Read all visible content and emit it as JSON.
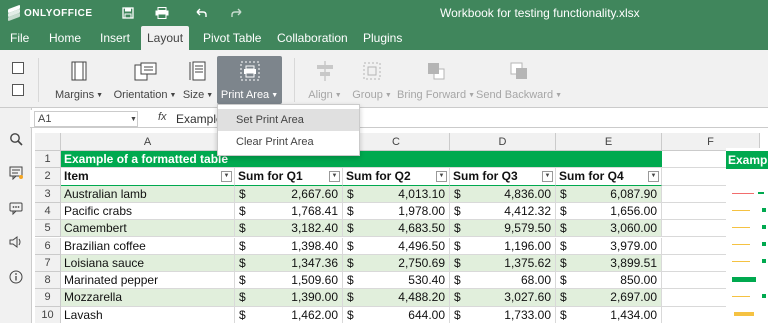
{
  "app": {
    "logo": "ONLYOFFICE",
    "title": "Workbook for testing functionality.xlsx"
  },
  "menu": {
    "tabs": [
      "File",
      "Home",
      "Insert",
      "Layout",
      "Pivot Table",
      "Collaboration",
      "Plugins"
    ],
    "active": "Layout"
  },
  "toolbar": {
    "margins": "Margins",
    "orientation": "Orientation",
    "size": "Size",
    "print_area": "Print Area",
    "align": "Align",
    "group": "Group",
    "bring_forward": "Bring Forward",
    "send_backward": "Send Backward"
  },
  "dropdown": {
    "items": [
      "Set Print Area",
      "Clear Print Area"
    ]
  },
  "formula": {
    "cell_ref": "A1",
    "fx": "fx",
    "content": "Example of a f"
  },
  "grid": {
    "columns": [
      "A",
      "B",
      "C",
      "D",
      "E",
      "F"
    ],
    "rows": [
      "1",
      "2",
      "3",
      "4",
      "5",
      "6",
      "7",
      "8",
      "9",
      "10"
    ],
    "title": "Example of a formatted table",
    "headers": [
      "Item",
      "Sum for Q1",
      "Sum for Q2",
      "Sum for Q3",
      "Sum for Q4"
    ],
    "currency": "$",
    "data": [
      [
        "Australian lamb",
        "2,667.60",
        "4,013.10",
        "4,836.00",
        "6,087.90"
      ],
      [
        "Pacific crabs",
        "1,768.41",
        "1,978.00",
        "4,412.32",
        "1,656.00"
      ],
      [
        "Camembert",
        "3,182.40",
        "4,683.50",
        "9,579.50",
        "3,060.00"
      ],
      [
        "Brazilian coffee",
        "1,398.40",
        "4,496.50",
        "1,196.00",
        "3,979.00"
      ],
      [
        "Loisiana sauce",
        "1,347.36",
        "2,750.69",
        "1,375.62",
        "3,899.51"
      ],
      [
        "Marinated pepper",
        "1,509.60",
        "530.40",
        "68.00",
        "850.00"
      ],
      [
        "Mozzarella",
        "1,390.00",
        "4,488.20",
        "3,027.60",
        "2,697.00"
      ],
      [
        "Lavash",
        "1,462.00",
        "644.00",
        "1,733.00",
        "1,434.00"
      ]
    ]
  },
  "panel": {
    "header": "Examp"
  },
  "colors": {
    "brand": "#40865c",
    "table_accent": "#00a94f",
    "band": "#e1efdc"
  }
}
